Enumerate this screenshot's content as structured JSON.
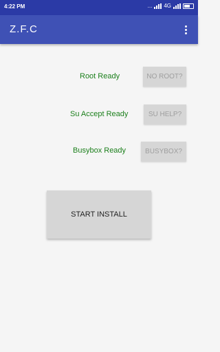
{
  "status_bar": {
    "time": "4:22 PM",
    "dots": "...",
    "network": "4G"
  },
  "app_bar": {
    "title": "Z.F.C",
    "overflow_icon": "more-vert-icon"
  },
  "checks": [
    {
      "label": "Root Ready",
      "button": "NO ROOT?"
    },
    {
      "label": "Su Accept Ready",
      "button": "SU HELP?"
    },
    {
      "label": "Busybox Ready",
      "button": "BUSYBOX?"
    }
  ],
  "install_button": "START INSTALL",
  "colors": {
    "status_bar": "#2b3aa6",
    "app_bar": "#3f51b5",
    "ready_text": "#1b7f1b",
    "button_bg": "#d6d6d6",
    "button_text_disabled": "#9e9e9e"
  }
}
